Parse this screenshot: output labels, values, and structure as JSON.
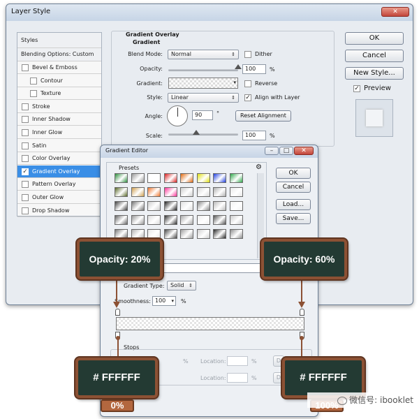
{
  "layer_style": {
    "title": "Layer Style",
    "styles_header": "Styles",
    "blending_options": "Blending Options: Custom",
    "style_items": [
      {
        "label": "Bevel & Emboss",
        "checked": false,
        "sub": false
      },
      {
        "label": "Contour",
        "checked": false,
        "sub": true
      },
      {
        "label": "Texture",
        "checked": false,
        "sub": true
      },
      {
        "label": "Stroke",
        "checked": false,
        "sub": false
      },
      {
        "label": "Inner Shadow",
        "checked": false,
        "sub": false
      },
      {
        "label": "Inner Glow",
        "checked": false,
        "sub": false
      },
      {
        "label": "Satin",
        "checked": false,
        "sub": false
      },
      {
        "label": "Color Overlay",
        "checked": false,
        "sub": false
      },
      {
        "label": "Gradient Overlay",
        "checked": true,
        "sub": false,
        "active": true
      },
      {
        "label": "Pattern Overlay",
        "checked": false,
        "sub": false
      },
      {
        "label": "Outer Glow",
        "checked": false,
        "sub": false
      },
      {
        "label": "Drop Shadow",
        "checked": false,
        "sub": false
      }
    ],
    "section_title": "Gradient Overlay",
    "section_subtitle": "Gradient",
    "blend_mode_label": "Blend Mode:",
    "blend_mode_value": "Normal",
    "dither_label": "Dither",
    "opacity_label": "Opacity:",
    "opacity_value": "100",
    "opacity_level": 1.0,
    "percent": "%",
    "gradient_label": "Gradient:",
    "reverse_label": "Reverse",
    "style_label": "Style:",
    "style_value": "Linear",
    "align_label": "Align with Layer",
    "angle_label": "Angle:",
    "angle_value": "90",
    "degree": "°",
    "reset_alignment": "Reset Alignment",
    "scale_label": "Scale:",
    "scale_value": "100",
    "scale_level": 0.4,
    "ok": "OK",
    "cancel": "Cancel",
    "new_style": "New Style...",
    "preview_label": "Preview"
  },
  "gradient_editor": {
    "title": "Gradient Editor",
    "presets_label": "Presets",
    "ok": "OK",
    "reset": "Cancel",
    "load": "Load...",
    "save": "Save...",
    "gradient_type_label": "Gradient Type:",
    "gradient_type_value": "Solid",
    "smoothness_label": "Smoothness:",
    "smoothness_value": "100",
    "percent": "%",
    "stops_label": "Stops",
    "location_label": "Location:",
    "delete_label": "D",
    "preset_colors": [
      [
        "#2f8f3f",
        "#9a9a9a",
        "#ffffff",
        "#d92020",
        "#e06a10",
        "#e0e010",
        "#2040e0",
        "#2fa84a"
      ],
      [
        "#5a6a2a",
        "#d0a050",
        "#f07830",
        "#ff3399",
        "#cfcfcf",
        "#d8d8d8",
        "#b0b0b0",
        "#e9e9e9"
      ],
      [
        "#444444",
        "#777777",
        "#cfcfcf",
        "#222222",
        "#e0e0e0",
        "#8a8a8a",
        "#bbbbbb",
        "#f2f2f2"
      ],
      [
        "#666666",
        "#999999",
        "#dddddd",
        "#333333",
        "#aaaaaa",
        "#efefef",
        "#555555",
        "#cccccc"
      ],
      [
        "#7a7a7a",
        "#b5b5b5",
        "#e8e8e8",
        "#4a4a4a",
        "#a0a0a0",
        "#d0d0d0",
        "#2a2a2a",
        "#909090"
      ]
    ]
  },
  "annotations": {
    "left_opacity": "Opacity: 20%",
    "right_opacity": "Opacity: 60%",
    "left_color": "# FFFFFF",
    "right_color": "# FFFFFF",
    "left_location": "0%",
    "right_location": "100%",
    "accent_wood": "#8c5134",
    "board_green": "#233a33"
  },
  "watermark": "微信号: ibooklet"
}
